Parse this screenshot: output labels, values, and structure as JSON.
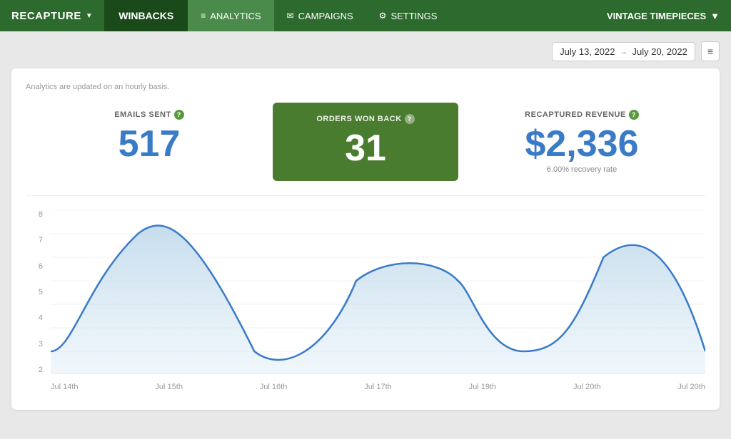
{
  "nav": {
    "brand": "RECAPTURE",
    "brand_chevron": "▼",
    "winbacks": "WINBACKS",
    "items": [
      {
        "label": "ANALYTICS",
        "icon": "≡",
        "active": true
      },
      {
        "label": "CAMPAIGNS",
        "icon": "✉",
        "active": false
      },
      {
        "label": "SETTINGS",
        "icon": "⚙",
        "active": false
      }
    ],
    "right_label": "VINTAGE TIMEPIECES",
    "right_chevron": "▼"
  },
  "date_range": {
    "start": "July 13, 2022",
    "end": "July 20, 2022"
  },
  "analytics_note": "Analytics are updated on an hourly basis.",
  "stats": [
    {
      "label": "EMAILS SENT",
      "value": "517",
      "sub": "",
      "highlight": false
    },
    {
      "label": "ORDERS WON BACK",
      "value": "31",
      "sub": "",
      "highlight": true
    },
    {
      "label": "RECAPTURED REVENUE",
      "value": "$2,336",
      "sub": "6.00% recovery rate",
      "highlight": false
    }
  ],
  "chart": {
    "y_labels": [
      "8",
      "7",
      "6",
      "5",
      "4",
      "3",
      "2"
    ],
    "x_labels": [
      "Jul 14th",
      "Jul 15th",
      "Jul 16th",
      "Jul 17th",
      "Jul 19th",
      "Jul 20th",
      "Jul 20th"
    ]
  }
}
